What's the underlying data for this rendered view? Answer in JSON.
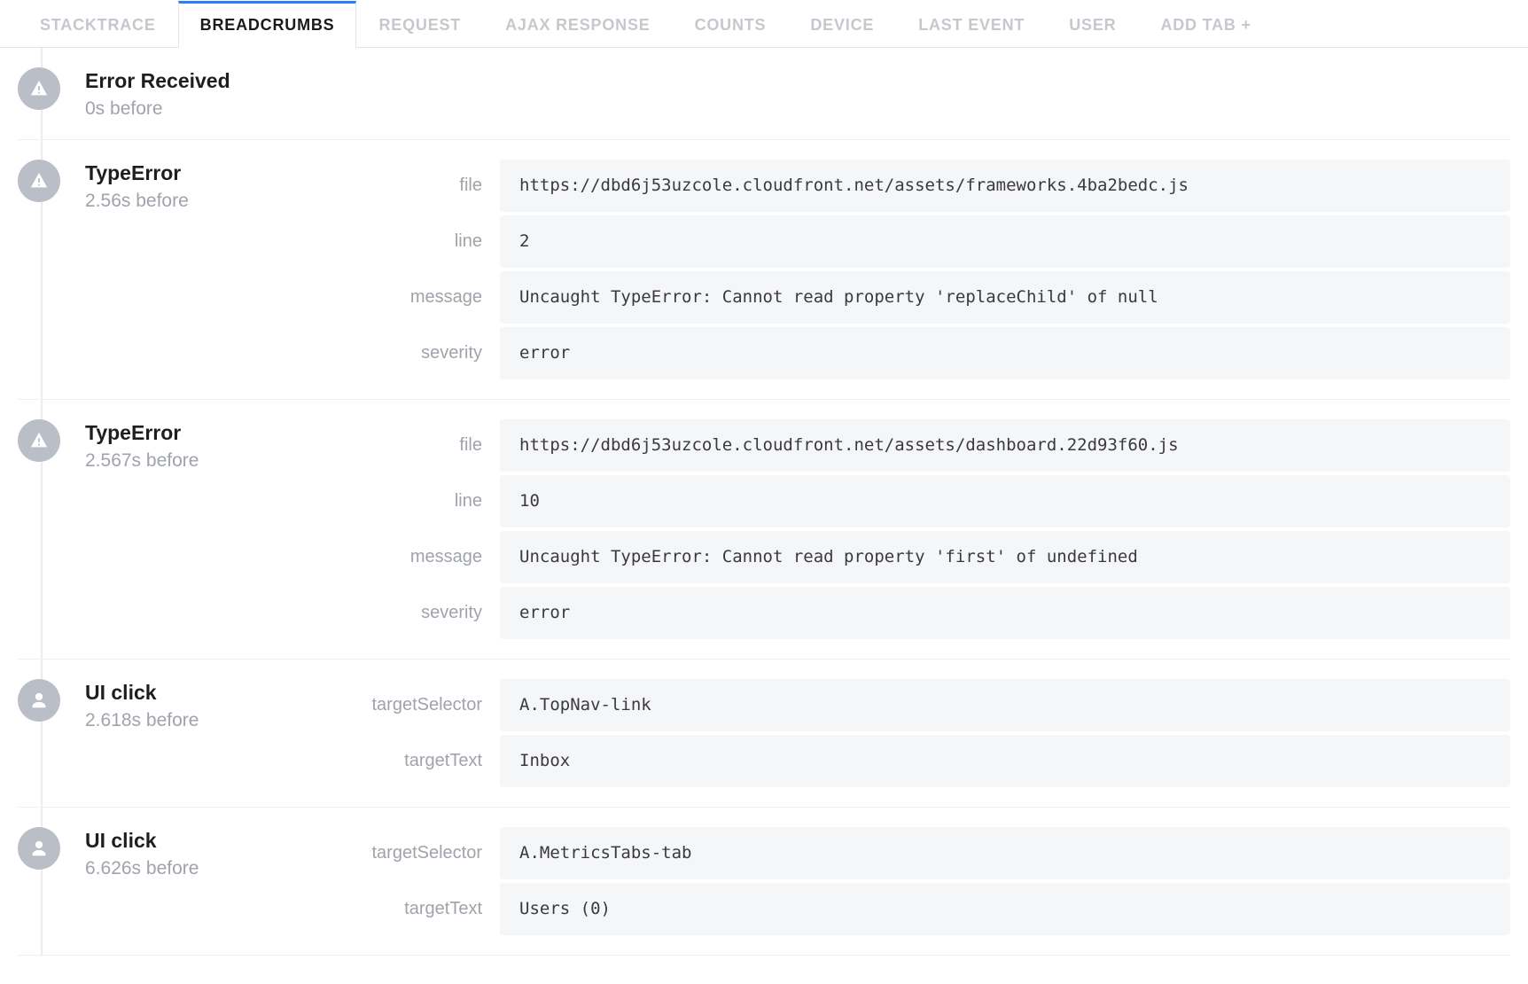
{
  "tabs": [
    {
      "label": "STACKTRACE",
      "active": false
    },
    {
      "label": "BREADCRUMBS",
      "active": true
    },
    {
      "label": "REQUEST",
      "active": false
    },
    {
      "label": "AJAX RESPONSE",
      "active": false
    },
    {
      "label": "COUNTS",
      "active": false
    },
    {
      "label": "DEVICE",
      "active": false
    },
    {
      "label": "LAST EVENT",
      "active": false
    },
    {
      "label": "USER",
      "active": false
    }
  ],
  "add_tab_label": "ADD TAB +",
  "entries": [
    {
      "icon": "warning",
      "title": "Error Received",
      "time": "0s before",
      "details": []
    },
    {
      "icon": "warning",
      "title": "TypeError",
      "time": "2.56s before",
      "details": [
        {
          "key": "file",
          "value": "https://dbd6j53uzcole.cloudfront.net/assets/frameworks.4ba2bedc.js"
        },
        {
          "key": "line",
          "value": "2"
        },
        {
          "key": "message",
          "value": "Uncaught TypeError: Cannot read property 'replaceChild' of null"
        },
        {
          "key": "severity",
          "value": "error"
        }
      ]
    },
    {
      "icon": "warning",
      "title": "TypeError",
      "time": "2.567s before",
      "details": [
        {
          "key": "file",
          "value": "https://dbd6j53uzcole.cloudfront.net/assets/dashboard.22d93f60.js"
        },
        {
          "key": "line",
          "value": "10"
        },
        {
          "key": "message",
          "value": "Uncaught TypeError: Cannot read property 'first' of undefined"
        },
        {
          "key": "severity",
          "value": "error"
        }
      ]
    },
    {
      "icon": "user",
      "title": "UI click",
      "time": "2.618s before",
      "details": [
        {
          "key": "targetSelector",
          "value": "A.TopNav-link"
        },
        {
          "key": "targetText",
          "value": "Inbox"
        }
      ]
    },
    {
      "icon": "user",
      "title": "UI click",
      "time": "6.626s before",
      "details": [
        {
          "key": "targetSelector",
          "value": "A.MetricsTabs-tab"
        },
        {
          "key": "targetText",
          "value": "Users (0)"
        }
      ]
    }
  ]
}
